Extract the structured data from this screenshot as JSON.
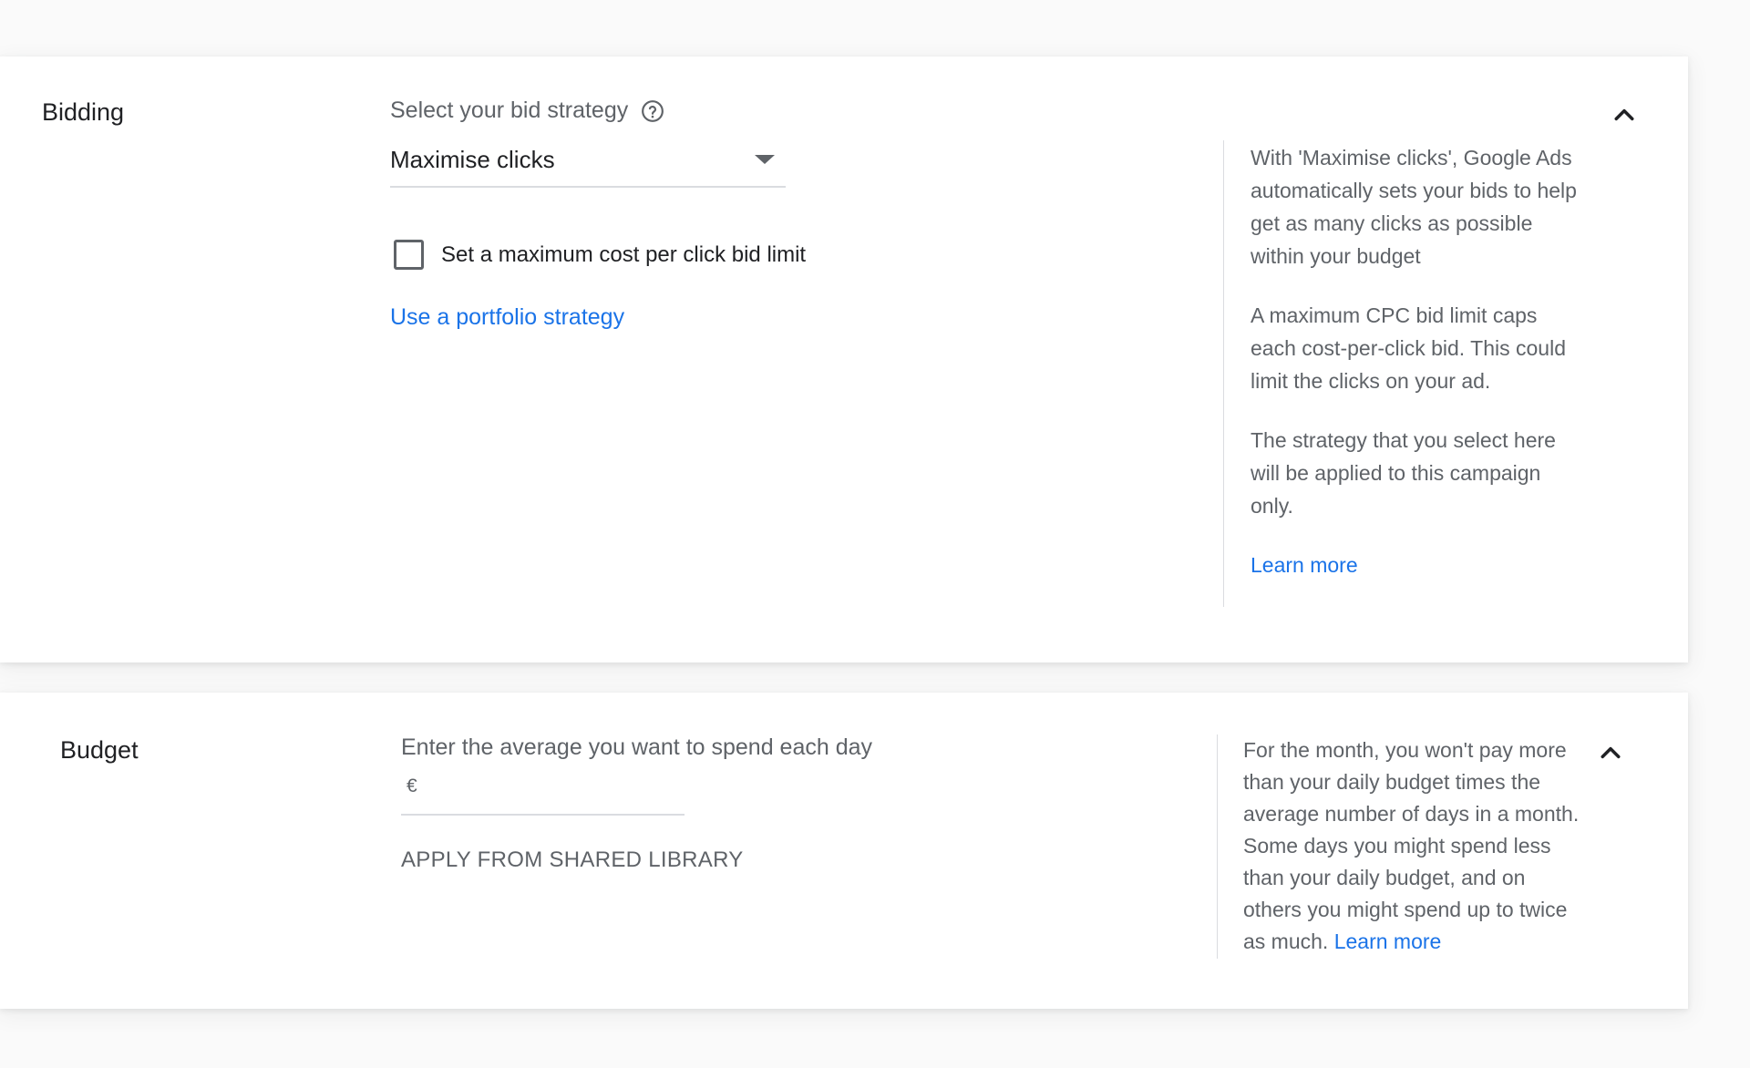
{
  "bidding": {
    "title": "Bidding",
    "strategy_label": "Select your bid strategy",
    "strategy_value": "Maximise clicks",
    "max_cpc_checkbox_label": "Set a maximum cost per click bid limit",
    "portfolio_link": "Use a portfolio strategy",
    "info": {
      "paragraph1": "With 'Maximise clicks', Google Ads automatically sets your bids to help get as many clicks as possible within your budget",
      "paragraph2": "A maximum CPC bid limit caps each cost-per-click bid. This could limit the clicks on your ad.",
      "paragraph3": "The strategy that you select here will be applied to this campaign only.",
      "learn_more": "Learn more"
    }
  },
  "budget": {
    "title": "Budget",
    "input_label": "Enter the average you want to spend each day",
    "currency_symbol": "€",
    "input_value": "",
    "shared_library_button": "APPLY FROM SHARED LIBRARY",
    "info": {
      "text": "For the month, you won't pay more than your daily budget times the average number of days in a month. Some days you might spend less than your daily budget, and on others you might spend up to twice as much.",
      "learn_more": "Learn more"
    }
  },
  "icons": {
    "help": "help-circle-icon",
    "collapse": "chevron-up-icon",
    "dropdown": "dropdown-arrow-icon"
  },
  "colors": {
    "link": "#1a73e8",
    "text_primary": "#202124",
    "text_secondary": "#5f6368",
    "divider": "#dadce0"
  }
}
